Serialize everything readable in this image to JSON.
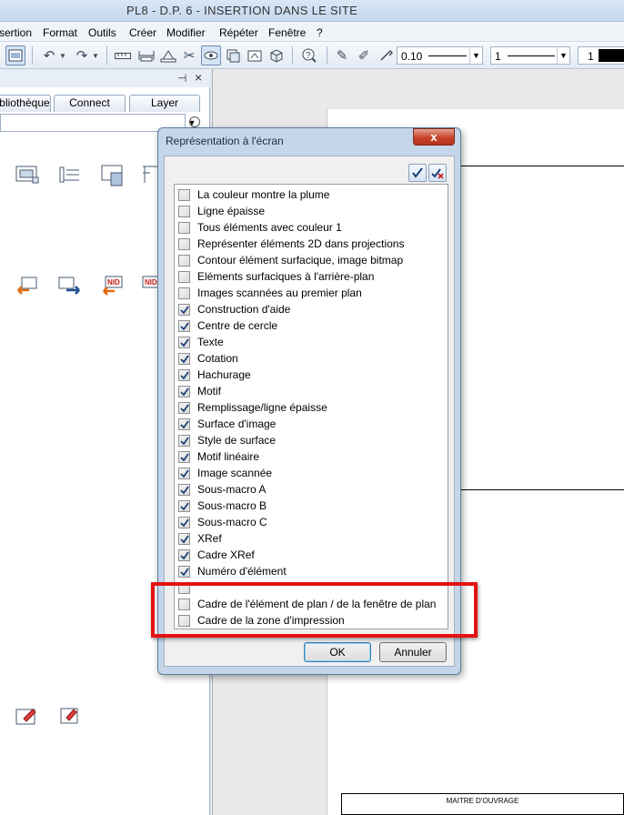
{
  "window": {
    "title": "PL8 - D.P. 6 - INSERTION DANS LE SITE"
  },
  "menu": [
    "sertion",
    "Format",
    "Outils",
    "Créer",
    "Modifier",
    "Répéter",
    "Fenêtre",
    "?"
  ],
  "toolbar": {
    "pen_thickness": "0.10",
    "line_type": "1",
    "color_value": "1"
  },
  "library_panel": {
    "tabs": [
      "bliothèque",
      "Connect",
      "Layer"
    ],
    "close_glyph": "×",
    "pin_glyph": "⊣"
  },
  "dialog": {
    "title": "Représentation à l'écran",
    "close_label": "x",
    "ok_label": "OK",
    "cancel_label": "Annuler",
    "options": [
      {
        "label": "La couleur montre la plume",
        "checked": false
      },
      {
        "label": "Ligne épaisse",
        "checked": false
      },
      {
        "label": "Tous éléments avec couleur 1",
        "checked": false
      },
      {
        "label": "Représenter éléments 2D dans projections",
        "checked": false
      },
      {
        "label": "Contour élément surfacique, image bitmap",
        "checked": false
      },
      {
        "label": "Eléments surfaciques à l'arrière-plan",
        "checked": false
      },
      {
        "label": "Images scannées au premier plan",
        "checked": false
      },
      {
        "label": "Construction d'aide",
        "checked": true
      },
      {
        "label": "Centre de cercle",
        "checked": true
      },
      {
        "label": "Texte",
        "checked": true
      },
      {
        "label": "Cotation",
        "checked": true
      },
      {
        "label": "Hachurage",
        "checked": true
      },
      {
        "label": "Motif",
        "checked": true
      },
      {
        "label": "Remplissage/ligne épaisse",
        "checked": true
      },
      {
        "label": "Surface d'image",
        "checked": true
      },
      {
        "label": "Style de surface",
        "checked": true
      },
      {
        "label": "Motif linéaire",
        "checked": true
      },
      {
        "label": "Image scannée",
        "checked": true
      },
      {
        "label": "Sous-macro A",
        "checked": true
      },
      {
        "label": "Sous-macro B",
        "checked": true
      },
      {
        "label": "Sous-macro C",
        "checked": true
      },
      {
        "label": "XRef",
        "checked": true
      },
      {
        "label": "Cadre XRef",
        "checked": true
      },
      {
        "label": "Numéro d'élément",
        "checked": true
      },
      {
        "label": "",
        "checked": false
      },
      {
        "label": "Cadre de l'élément de plan / de la fenêtre de plan",
        "checked": false
      },
      {
        "label": "Cadre de la zone d'impression",
        "checked": false
      }
    ]
  },
  "title_block": {
    "owner_label": "MAITRE D'OUVRAGE"
  },
  "colors": {
    "highlight": "#e41212",
    "check": "#1d3f7a"
  }
}
